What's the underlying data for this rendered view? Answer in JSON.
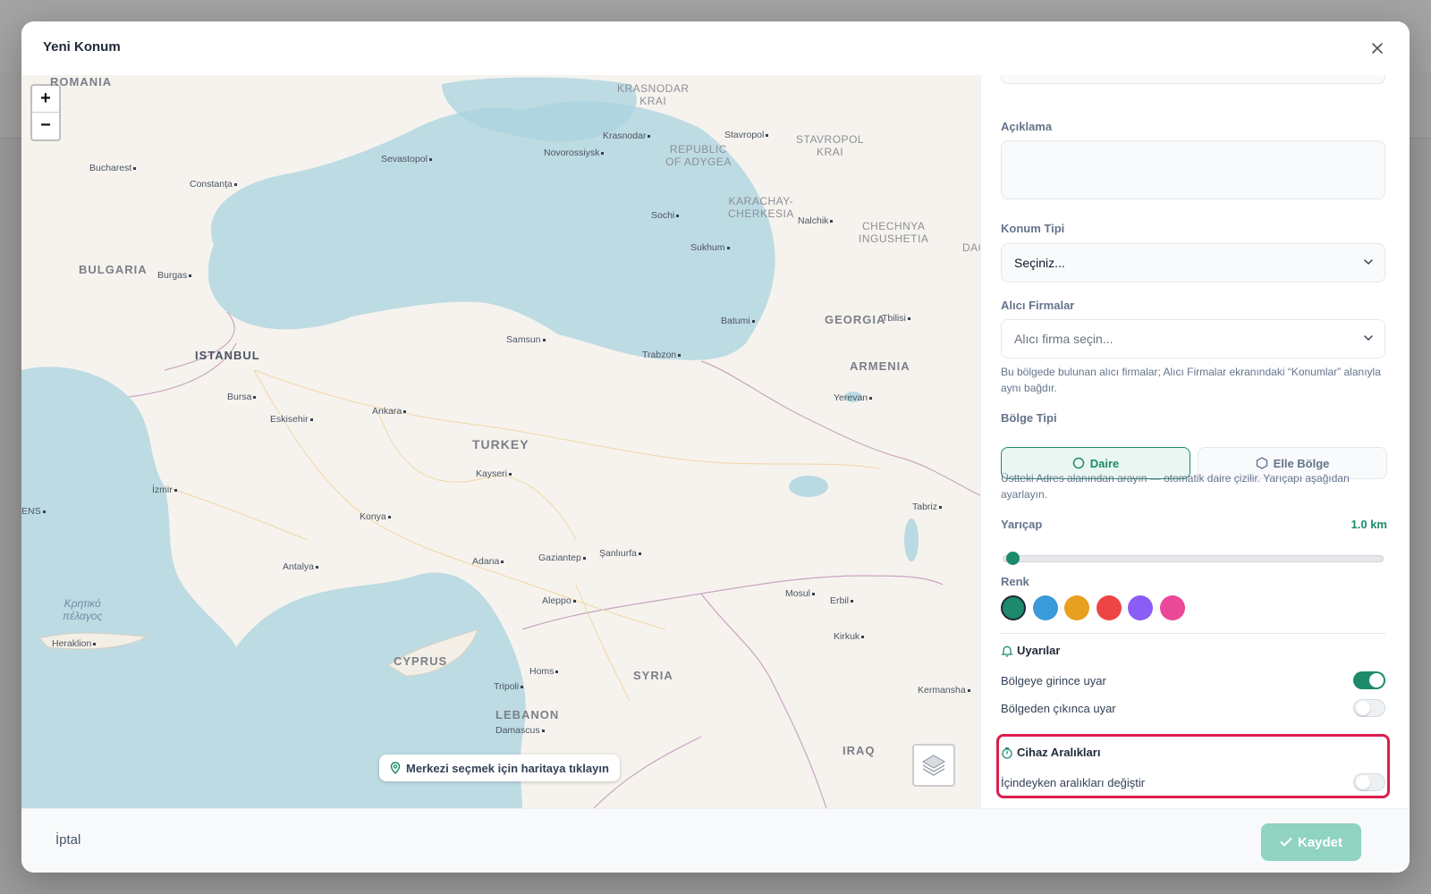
{
  "modal": {
    "title": "Yeni Konum"
  },
  "map": {
    "zoom_in": "+",
    "zoom_out": "−",
    "hint": "Merkezi seçmek için haritaya tıklayın",
    "labels": {
      "romania": "ROMANIA",
      "krasnodar": "KRASNODAR\nKRAI",
      "krasnodar_city": "Krasnodar",
      "stavropol": "Stavropol",
      "stavropol_krai": "STAVROPOL\nKRAI",
      "adygea": "REPUBLIC\nOF ADYGEA",
      "bucharest": "Bucharest",
      "constanta": "Constanța",
      "sevastopol": "Sevastopol",
      "novorossiysk": "Novorossiysk",
      "karachay": "KARACHAY-\nCHERKESIA",
      "nalchik": "Nalchik",
      "sochi": "Sochi",
      "chechnya": "CHECHNYA\nINGUSHETIA",
      "dag": "DAG",
      "bulgaria": "BULGARIA",
      "burgas": "Burgas",
      "sukhum": "Sukhum",
      "batumi": "Batumi",
      "georgia": "GEORGIA",
      "tbilisi": "Tbilisi",
      "istanbul": "ISTANBUL",
      "samsun": "Samsun",
      "trabzon": "Trabzon",
      "armenia": "ARMENIA",
      "bursa": "Bursa",
      "eskisehir": "Eskisehir",
      "ankara": "Ankara",
      "yerevan": "Yerevan",
      "turkey": "TURKEY",
      "kayseri": "Kayseri",
      "izmir": "İzmir",
      "tabriz": "Tabriz",
      "ens": "ENS",
      "konya": "Konya",
      "antalya": "Antalya",
      "adana": "Adana",
      "gaziantep": "Gaziantep",
      "sanliurfa": "Şanlıurfa",
      "aleppo": "Aleppo",
      "mosul": "Mosul",
      "erbil": "Erbil",
      "kretiko": "Κρητικό\nπέλαγος",
      "heraklion": "Heraklion",
      "kirkuk": "Kirkuk",
      "cyprus": "CYPRUS",
      "homs": "Homs",
      "syria": "SYRIA",
      "tripoli": "Tripoli",
      "kermanshah": "Kermansha",
      "lebanon": "LEBANON",
      "damascus": "Damascus",
      "iraq": "IRAQ"
    }
  },
  "form": {
    "aciklama_label": "Açıklama",
    "konum_tipi_label": "Konum Tipi",
    "konum_tipi_value": "Seçiniz...",
    "alici_label": "Alıcı Firmalar",
    "alici_placeholder": "Alıcı firma seçin...",
    "alici_help": "Bu bölgede bulunan alıcı firmalar; Alıcı Firmalar ekranındaki “Konumlar” alanıyla aynı bağdır.",
    "bolge_tipi_label": "Bölge Tipi",
    "region_circle": "Daire",
    "region_manual": "Elle Bölge",
    "region_help": "Üstteki Adres alanından arayın — otomatik daire çizilir. Yarıçapı aşağıdan ayarlayın.",
    "radius_label": "Yarıçap",
    "radius_value": "1.0 km",
    "radius_fraction": 0.01,
    "color_label": "Renk",
    "colors": [
      "#1d8a6b",
      "#3b9ad9",
      "#e8a020",
      "#ef4444",
      "#8b5cf6",
      "#ec4899"
    ],
    "selected_color": "#1d8a6b"
  },
  "alerts": {
    "title": "Uyarılar",
    "enter_label": "Bölgeye girince uyar",
    "enter_on": true,
    "exit_label": "Bölgeden çıkınca uyar",
    "exit_on": false
  },
  "intervals": {
    "title": "Cihaz Aralıkları",
    "change_label": "İçindeyken aralıkları değiştir",
    "change_on": false
  },
  "footer": {
    "cancel": "İptal",
    "save": "Kaydet"
  },
  "accent": "#1d8a6b",
  "highlight_color": "#dc1e4e"
}
